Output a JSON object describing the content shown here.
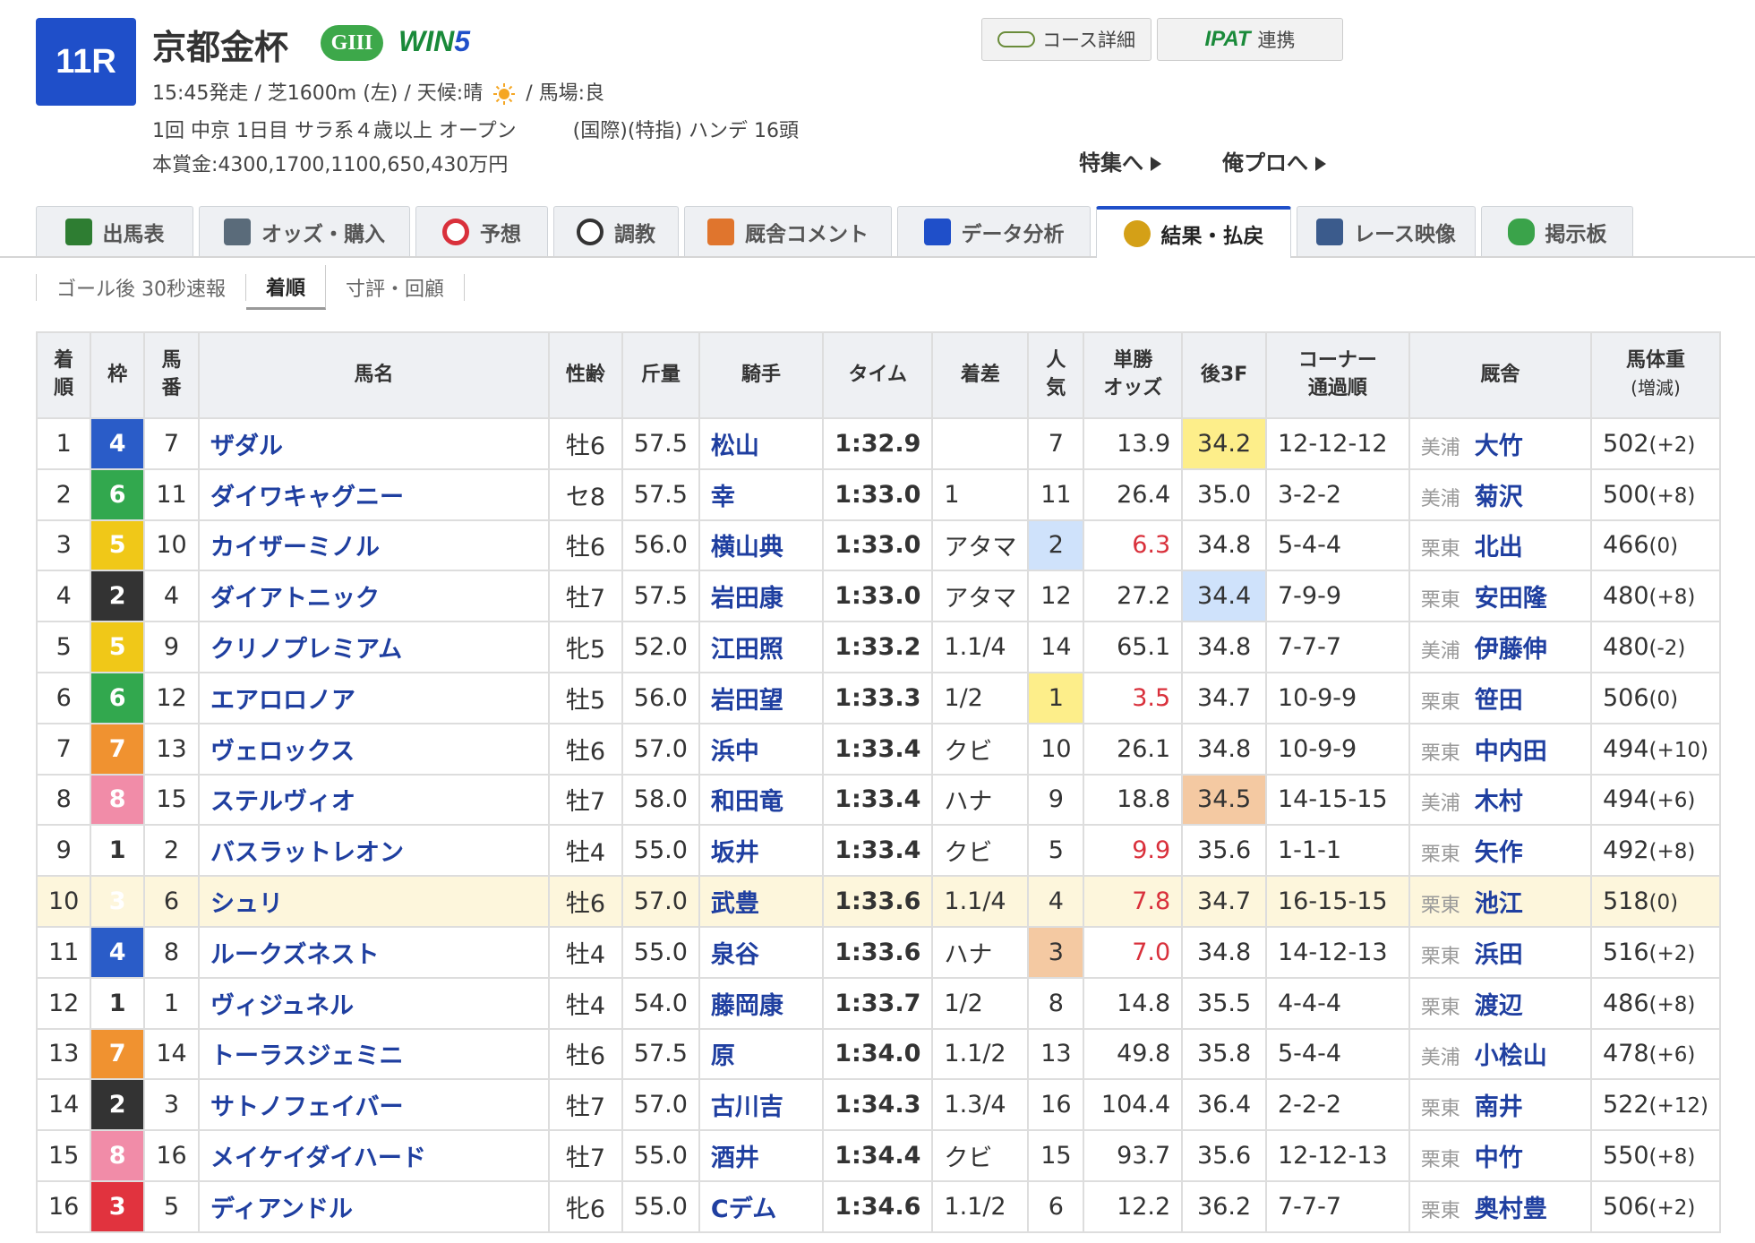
{
  "race": {
    "number": "11R",
    "name": "京都金杯",
    "grade": "GIII",
    "win5_a": "WIN",
    "win5_b": "5",
    "line1_a": "15:45発走 / 芝1600m (左) / 天候:晴",
    "line1_b": "/ 馬場:良",
    "line2_a": "1回 中京 1日目 サラ系４歳以上 オープン",
    "line2_b": "(国際)(特指) ハンデ 16頭",
    "prize": "本賞金:4300,1700,1100,650,430万円"
  },
  "buttons": {
    "course": "コース詳細",
    "ipat_logo": "IPAT",
    "ipat": "連携"
  },
  "links": {
    "feature": "特集へ",
    "orepro": "俺プロへ"
  },
  "tabs": [
    {
      "label": "出馬表",
      "icon": "entry-table-icon",
      "color": "#2e7d32"
    },
    {
      "label": "オッズ・購入",
      "icon": "ipat-register-icon",
      "color": "#5a6b7a"
    },
    {
      "label": "予想",
      "icon": "target-icon",
      "color": "#d9303b"
    },
    {
      "label": "調教",
      "icon": "stopwatch-icon",
      "color": "#333333"
    },
    {
      "label": "厩舎コメント",
      "icon": "stable-icon",
      "color": "#e0752d"
    },
    {
      "label": "データ分析",
      "icon": "bar-chart-icon",
      "color": "#1f4fc9"
    },
    {
      "label": "結果・払戻",
      "icon": "coins-icon",
      "color": "#d4a017"
    },
    {
      "label": "レース映像",
      "icon": "video-icon",
      "color": "#3b5b8c"
    },
    {
      "label": "掲示板",
      "icon": "chat-bubble-icon",
      "color": "#3aa34a"
    }
  ],
  "subtabs": [
    "ゴール後 30秒速報",
    "着順",
    "寸評・回顧"
  ],
  "table": {
    "headers": {
      "rank_a": "着",
      "rank_b": "順",
      "waku": "枠",
      "num_a": "馬",
      "num_b": "番",
      "horse": "馬名",
      "sexage": "性齢",
      "weight": "斤量",
      "jockey": "騎手",
      "time": "タイム",
      "margin": "着差",
      "pop_a": "人",
      "pop_b": "気",
      "odds_a": "単勝",
      "odds_b": "オッズ",
      "last3f": "後3F",
      "corner_a": "コーナー",
      "corner_b": "通過順",
      "trainer": "厩舎",
      "bodyweight_a": "馬体重",
      "bodyweight_b": "(増減)"
    },
    "rows": [
      {
        "rank": "1",
        "waku": "4",
        "num": "7",
        "horse": "ザダル",
        "sexage": "牡6",
        "weight": "57.5",
        "jockey": "松山",
        "time": "1:32.9",
        "margin": "",
        "pop": "7",
        "odds": "13.9",
        "last3f": "34.2",
        "corner": "12-12-12",
        "region": "美浦",
        "trainer": "大竹",
        "bw": "502",
        "bwd": "(+2)"
      },
      {
        "rank": "2",
        "waku": "6",
        "num": "11",
        "horse": "ダイワキャグニー",
        "sexage": "セ8",
        "weight": "57.5",
        "jockey": "幸",
        "time": "1:33.0",
        "margin": "1",
        "pop": "11",
        "odds": "26.4",
        "last3f": "35.0",
        "corner": "3-2-2",
        "region": "美浦",
        "trainer": "菊沢",
        "bw": "500",
        "bwd": "(+8)"
      },
      {
        "rank": "3",
        "waku": "5",
        "num": "10",
        "horse": "カイザーミノル",
        "sexage": "牡6",
        "weight": "56.0",
        "jockey": "横山典",
        "time": "1:33.0",
        "margin": "アタマ",
        "pop": "2",
        "odds": "6.3",
        "last3f": "34.8",
        "corner": "5-4-4",
        "region": "栗東",
        "trainer": "北出",
        "bw": "466",
        "bwd": "(0)"
      },
      {
        "rank": "4",
        "waku": "2",
        "num": "4",
        "horse": "ダイアトニック",
        "sexage": "牡7",
        "weight": "57.5",
        "jockey": "岩田康",
        "time": "1:33.0",
        "margin": "アタマ",
        "pop": "12",
        "odds": "27.2",
        "last3f": "34.4",
        "corner": "7-9-9",
        "region": "栗東",
        "trainer": "安田隆",
        "bw": "480",
        "bwd": "(+8)"
      },
      {
        "rank": "5",
        "waku": "5",
        "num": "9",
        "horse": "クリノプレミアム",
        "sexage": "牝5",
        "weight": "52.0",
        "jockey": "江田照",
        "time": "1:33.2",
        "margin": "1.1/4",
        "pop": "14",
        "odds": "65.1",
        "last3f": "34.8",
        "corner": "7-7-7",
        "region": "美浦",
        "trainer": "伊藤伸",
        "bw": "480",
        "bwd": "(-2)"
      },
      {
        "rank": "6",
        "waku": "6",
        "num": "12",
        "horse": "エアロロノア",
        "sexage": "牡5",
        "weight": "56.0",
        "jockey": "岩田望",
        "time": "1:33.3",
        "margin": "1/2",
        "pop": "1",
        "odds": "3.5",
        "last3f": "34.7",
        "corner": "10-9-9",
        "region": "栗東",
        "trainer": "笹田",
        "bw": "506",
        "bwd": "(0)"
      },
      {
        "rank": "7",
        "waku": "7",
        "num": "13",
        "horse": "ヴェロックス",
        "sexage": "牡6",
        "weight": "57.0",
        "jockey": "浜中",
        "time": "1:33.4",
        "margin": "クビ",
        "pop": "10",
        "odds": "26.1",
        "last3f": "34.8",
        "corner": "10-9-9",
        "region": "栗東",
        "trainer": "中内田",
        "bw": "494",
        "bwd": "(+10)"
      },
      {
        "rank": "8",
        "waku": "8",
        "num": "15",
        "horse": "ステルヴィオ",
        "sexage": "牡7",
        "weight": "58.0",
        "jockey": "和田竜",
        "time": "1:33.4",
        "margin": "ハナ",
        "pop": "9",
        "odds": "18.8",
        "last3f": "34.5",
        "corner": "14-15-15",
        "region": "美浦",
        "trainer": "木村",
        "bw": "494",
        "bwd": "(+6)"
      },
      {
        "rank": "9",
        "waku": "1",
        "num": "2",
        "horse": "バスラットレオン",
        "sexage": "牡4",
        "weight": "55.0",
        "jockey": "坂井",
        "time": "1:33.4",
        "margin": "クビ",
        "pop": "5",
        "odds": "9.9",
        "last3f": "35.6",
        "corner": "1-1-1",
        "region": "栗東",
        "trainer": "矢作",
        "bw": "492",
        "bwd": "(+8)"
      },
      {
        "rank": "10",
        "waku": "3",
        "num": "6",
        "horse": "シュリ",
        "sexage": "牡6",
        "weight": "57.0",
        "jockey": "武豊",
        "time": "1:33.6",
        "margin": "1.1/4",
        "pop": "4",
        "odds": "7.8",
        "last3f": "34.7",
        "corner": "16-15-15",
        "region": "栗東",
        "trainer": "池江",
        "bw": "518",
        "bwd": "(0)"
      },
      {
        "rank": "11",
        "waku": "4",
        "num": "8",
        "horse": "ルークズネスト",
        "sexage": "牡4",
        "weight": "55.0",
        "jockey": "泉谷",
        "time": "1:33.6",
        "margin": "ハナ",
        "pop": "3",
        "odds": "7.0",
        "last3f": "34.8",
        "corner": "14-12-13",
        "region": "栗東",
        "trainer": "浜田",
        "bw": "516",
        "bwd": "(+2)"
      },
      {
        "rank": "12",
        "waku": "1",
        "num": "1",
        "horse": "ヴィジュネル",
        "sexage": "牡4",
        "weight": "54.0",
        "jockey": "藤岡康",
        "time": "1:33.7",
        "margin": "1/2",
        "pop": "8",
        "odds": "14.8",
        "last3f": "35.5",
        "corner": "4-4-4",
        "region": "栗東",
        "trainer": "渡辺",
        "bw": "486",
        "bwd": "(+8)"
      },
      {
        "rank": "13",
        "waku": "7",
        "num": "14",
        "horse": "トーラスジェミニ",
        "sexage": "牡6",
        "weight": "57.5",
        "jockey": "原",
        "time": "1:34.0",
        "margin": "1.1/2",
        "pop": "13",
        "odds": "49.8",
        "last3f": "35.8",
        "corner": "5-4-4",
        "region": "美浦",
        "trainer": "小桧山",
        "bw": "478",
        "bwd": "(+6)"
      },
      {
        "rank": "14",
        "waku": "2",
        "num": "3",
        "horse": "サトノフェイバー",
        "sexage": "牡7",
        "weight": "57.0",
        "jockey": "古川吉",
        "time": "1:34.3",
        "margin": "1.3/4",
        "pop": "16",
        "odds": "104.4",
        "last3f": "36.4",
        "corner": "2-2-2",
        "region": "栗東",
        "trainer": "南井",
        "bw": "522",
        "bwd": "(+12)"
      },
      {
        "rank": "15",
        "waku": "8",
        "num": "16",
        "horse": "メイケイダイハード",
        "sexage": "牡7",
        "weight": "55.0",
        "jockey": "酒井",
        "time": "1:34.4",
        "margin": "クビ",
        "pop": "15",
        "odds": "93.7",
        "last3f": "35.6",
        "corner": "12-12-13",
        "region": "栗東",
        "trainer": "中竹",
        "bw": "550",
        "bwd": "(+8)"
      },
      {
        "rank": "16",
        "waku": "3",
        "num": "5",
        "horse": "ディアンドル",
        "sexage": "牝6",
        "weight": "55.0",
        "jockey": "Cデム",
        "time": "1:34.6",
        "margin": "1.1/2",
        "pop": "6",
        "odds": "12.2",
        "last3f": "36.2",
        "corner": "7-7-7",
        "region": "栗東",
        "trainer": "奥村豊",
        "bw": "506",
        "bwd": "(+2)"
      }
    ],
    "highlights": {
      "last3f": {
        "1": "hl-yellow",
        "4": "hl-blue",
        "8": "hl-orange"
      },
      "pop": {
        "3": "hl-blue",
        "6": "hl-yellow",
        "11": "hl-orange"
      },
      "red_odds_ranks": [
        "3",
        "6",
        "9",
        "10",
        "11"
      ],
      "highlight_row_rank": "10"
    }
  }
}
